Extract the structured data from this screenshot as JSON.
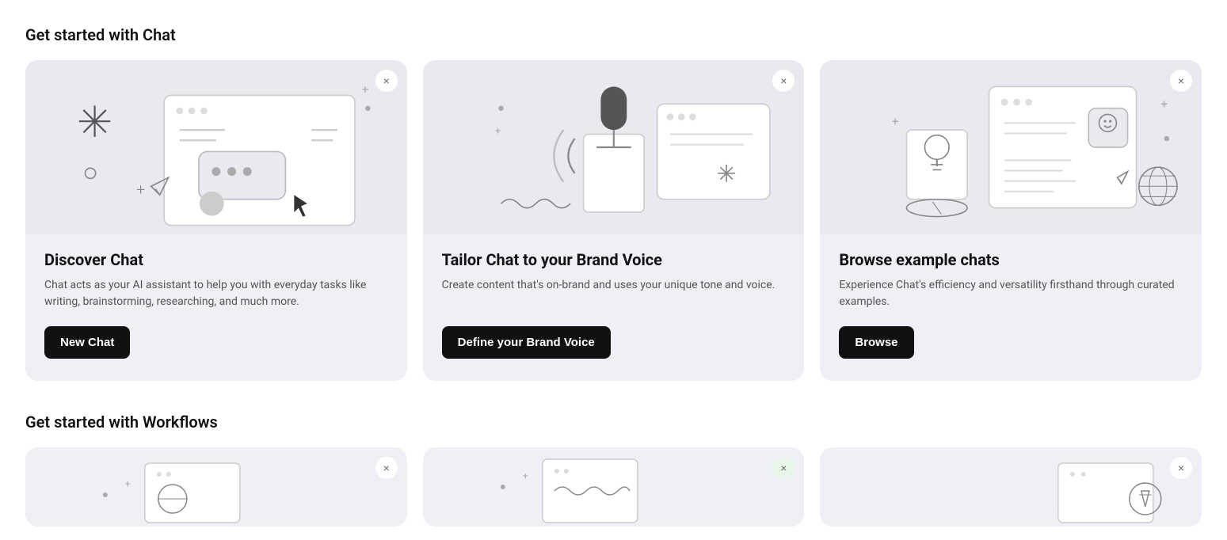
{
  "chat_section": {
    "title": "Get started with Chat",
    "cards": [
      {
        "id": "discover-chat",
        "heading": "Discover Chat",
        "description": "Chat acts as your AI assistant to help you with everyday tasks like writing, brainstorming, researching, and much more.",
        "button_label": "New Chat",
        "close_label": "×"
      },
      {
        "id": "brand-voice",
        "heading": "Tailor Chat to your Brand Voice",
        "description": "Create content that's on-brand and uses your unique tone and voice.",
        "button_label": "Define your Brand Voice",
        "close_label": "×"
      },
      {
        "id": "browse-chats",
        "heading": "Browse example chats",
        "description": "Experience Chat's efficiency and versatility firsthand through curated examples.",
        "button_label": "Browse",
        "close_label": "×"
      }
    ]
  },
  "workflows_section": {
    "title": "Get started with Workflows",
    "cards": [
      {
        "id": "workflow-1",
        "close_label": "×"
      },
      {
        "id": "workflow-2",
        "close_label": "×"
      },
      {
        "id": "workflow-3",
        "close_label": "×"
      }
    ]
  }
}
